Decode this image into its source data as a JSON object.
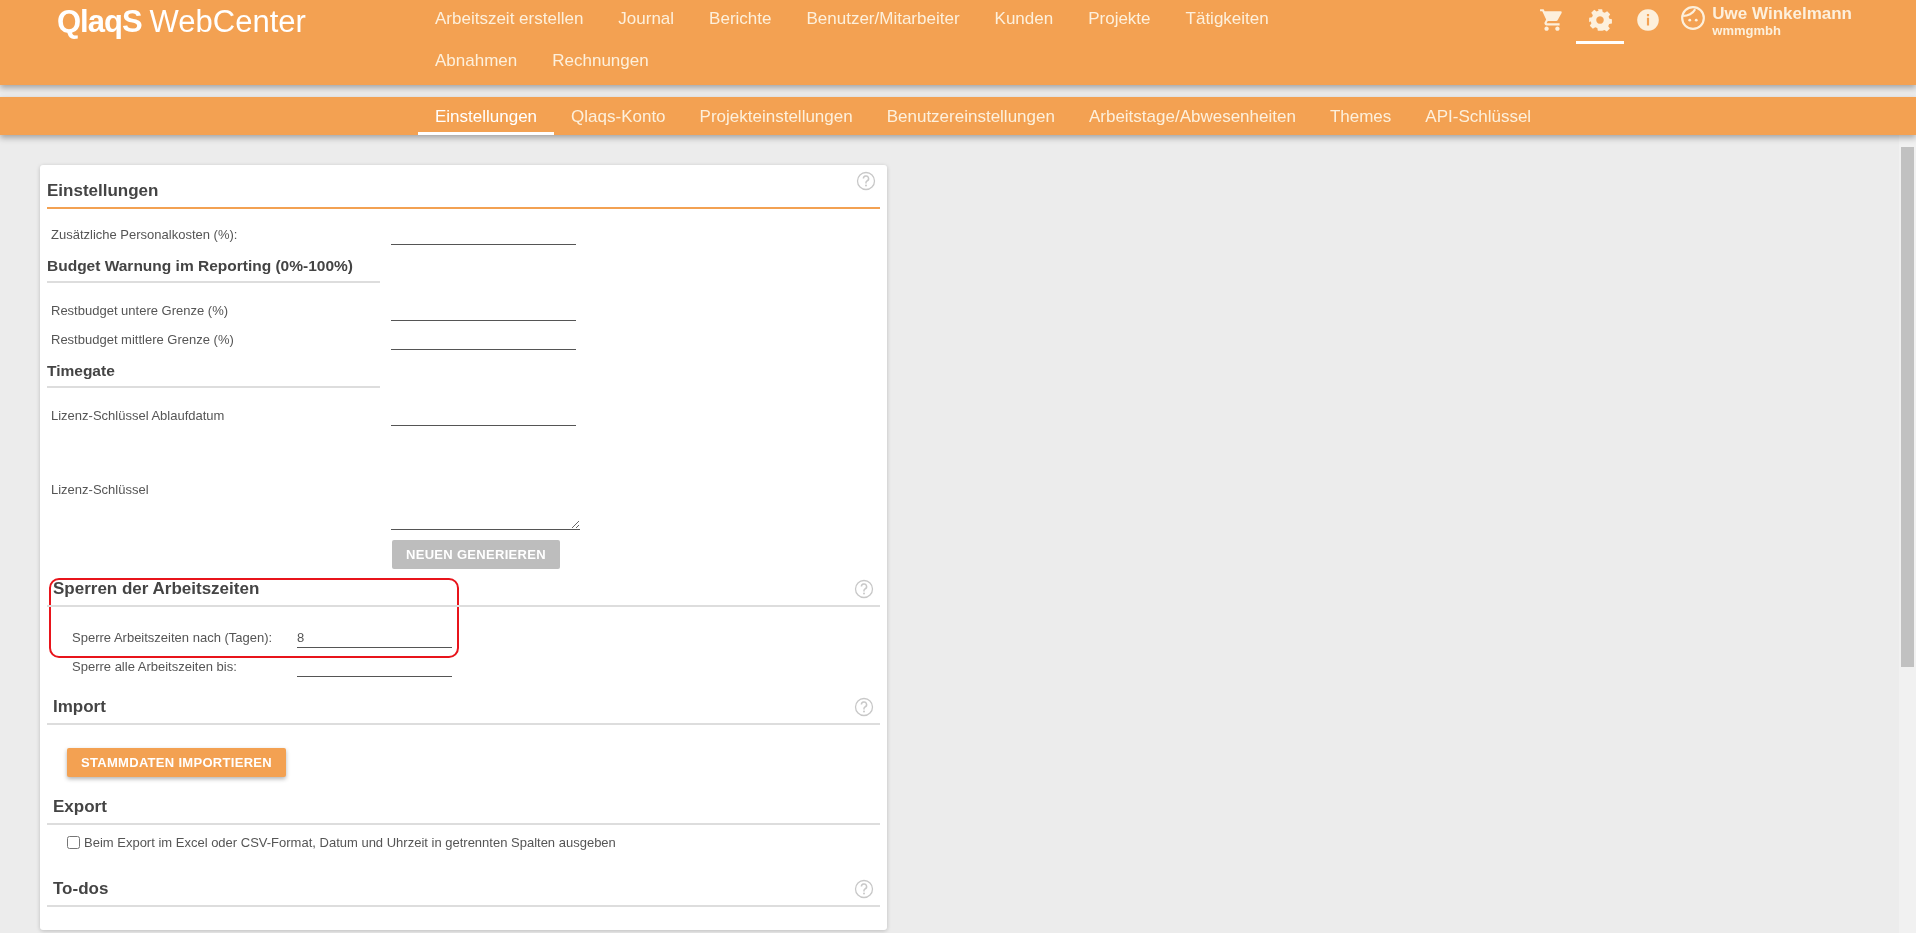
{
  "header": {
    "logo": {
      "mark": "QlaqS",
      "product": "WebCenter"
    },
    "nav": [
      "Arbeitszeit erstellen",
      "Journal",
      "Berichte",
      "Benutzer/Mitarbeiter",
      "Kunden",
      "Projekte",
      "Tätigkeiten",
      "Abnahmen",
      "Rechnungen"
    ],
    "icons": [
      {
        "kind": "cart",
        "selected": false
      },
      {
        "kind": "gear",
        "selected": true
      },
      {
        "kind": "info",
        "selected": false
      }
    ],
    "user": {
      "name": "Uwe Winkelmann",
      "company": "wmmgmbh"
    }
  },
  "tabs": [
    {
      "label": "Einstellungen",
      "selected": true
    },
    {
      "label": "Qlaqs-Konto",
      "selected": false
    },
    {
      "label": "Projekteinstellungen",
      "selected": false
    },
    {
      "label": "Benutzereinstellungen",
      "selected": false
    },
    {
      "label": "Arbeitstage/Abwesenheiten",
      "selected": false
    },
    {
      "label": "Themes",
      "selected": false
    },
    {
      "label": "API-Schlüssel",
      "selected": false
    }
  ],
  "panel": {
    "title": "Einstellungen",
    "help": true,
    "rows": [
      {
        "kind": "field",
        "label": "Zusätzliche Personalkosten (%):"
      },
      {
        "kind": "subheading",
        "label": "Budget Warnung im Reporting (0%-100%)"
      },
      {
        "kind": "field",
        "label": "Restbudget untere Grenze (%)"
      },
      {
        "kind": "field",
        "label": "Restbudget mittlere Grenze (%)"
      },
      {
        "kind": "subheading",
        "label": "Timegate"
      },
      {
        "kind": "field",
        "label": "Lizenz-Schlüssel Ablaufdatum"
      },
      {
        "kind": "textarea",
        "label": "Lizenz-Schlüssel"
      },
      {
        "kind": "button",
        "label": "NEUEN GENERIEREN",
        "disabled": true
      }
    ]
  },
  "sections": [
    {
      "title": "Sperren der Arbeitszeiten",
      "help": true,
      "highlighted": true,
      "rows": [
        {
          "kind": "field",
          "label": "Sperre Arbeitszeiten nach (Tagen):",
          "value": "8"
        },
        {
          "kind": "field",
          "label": "Sperre alle Arbeitszeiten bis:"
        }
      ]
    },
    {
      "title": "Import",
      "help": true,
      "highlighted": false,
      "rows": [
        {
          "kind": "button",
          "label": "STAMMDATEN IMPORTIEREN",
          "disabled": false
        }
      ]
    },
    {
      "title": "Export",
      "help": false,
      "highlighted": false,
      "rows": [
        {
          "kind": "checkbox",
          "label": "Beim Export im Excel oder CSV-Format, Datum und Uhrzeit in getrennten Spalten ausgeben",
          "checked": false
        }
      ]
    },
    {
      "title": "To-dos",
      "help": true,
      "highlighted": false
    }
  ]
}
